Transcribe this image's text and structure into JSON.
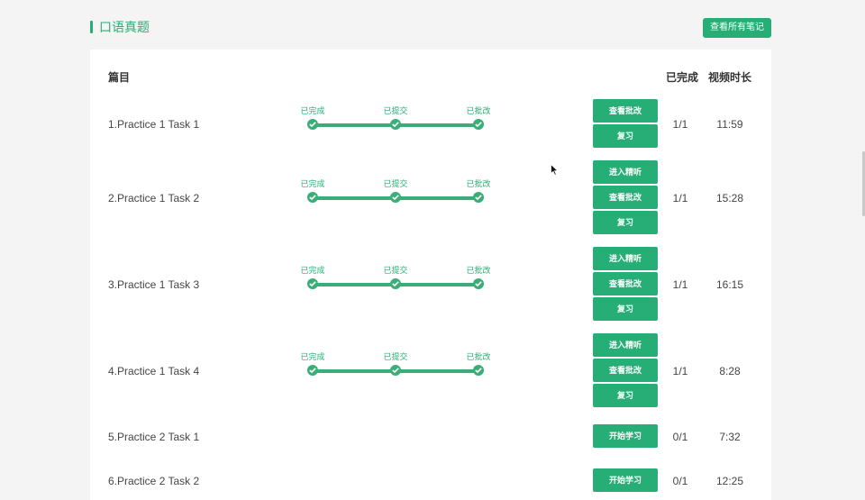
{
  "header": {
    "title": "口语真题",
    "notes_button": "查看所有笔记"
  },
  "columns": {
    "topic": "篇目",
    "completed": "已完成",
    "duration": "视频时长"
  },
  "progress_labels": [
    "已完成",
    "已提交",
    "已批改"
  ],
  "rows": [
    {
      "title": "1.Practice 1 Task 1",
      "count": "1/1",
      "duration": "11:59",
      "buttons": [
        "查看批改",
        "复习"
      ]
    },
    {
      "title": "2.Practice 1 Task 2",
      "count": "1/1",
      "duration": "15:28",
      "buttons": [
        "进入精听",
        "查看批改",
        "复习"
      ]
    },
    {
      "title": "3.Practice 1 Task 3",
      "count": "1/1",
      "duration": "16:15",
      "buttons": [
        "进入精听",
        "查看批改",
        "复习"
      ]
    },
    {
      "title": "4.Practice 1 Task 4",
      "count": "1/1",
      "duration": "8:28",
      "buttons": [
        "进入精听",
        "查看批改",
        "复习"
      ]
    },
    {
      "title": "5.Practice 2 Task 1",
      "count": "0/1",
      "duration": "7:32",
      "buttons": [
        "开始学习"
      ]
    },
    {
      "title": "6.Practice 2 Task 2",
      "count": "0/1",
      "duration": "12:25",
      "buttons": [
        "开始学习"
      ]
    }
  ],
  "colors": {
    "accent": "#27ae76",
    "progress": "#3aae76"
  }
}
